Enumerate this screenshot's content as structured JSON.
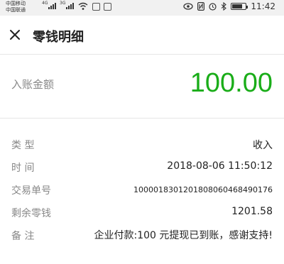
{
  "status_bar": {
    "carrier_1": "中国移动",
    "carrier_2": "中国联通",
    "signal_1_label": "4G",
    "signal_2_label": "3G",
    "time": "11:42",
    "battery_level": 0.75
  },
  "nav": {
    "close_icon": "close-icon",
    "title": "零钱明细"
  },
  "amount": {
    "label": "入账金额",
    "value": "100.00",
    "color": "#1aad19"
  },
  "details": [
    {
      "key": "type",
      "label": "类  型",
      "value": "收入"
    },
    {
      "key": "time",
      "label": "时  间",
      "value": "2018-08-06 11:50:12"
    },
    {
      "key": "order",
      "label": "交易单号",
      "value": "1000018301201808060468490176"
    },
    {
      "key": "balance",
      "label": "剩余零钱",
      "value": "1201.58"
    },
    {
      "key": "remark",
      "label": "备  注",
      "value": "企业付款:100 元提现已到账，感谢支持!"
    }
  ]
}
